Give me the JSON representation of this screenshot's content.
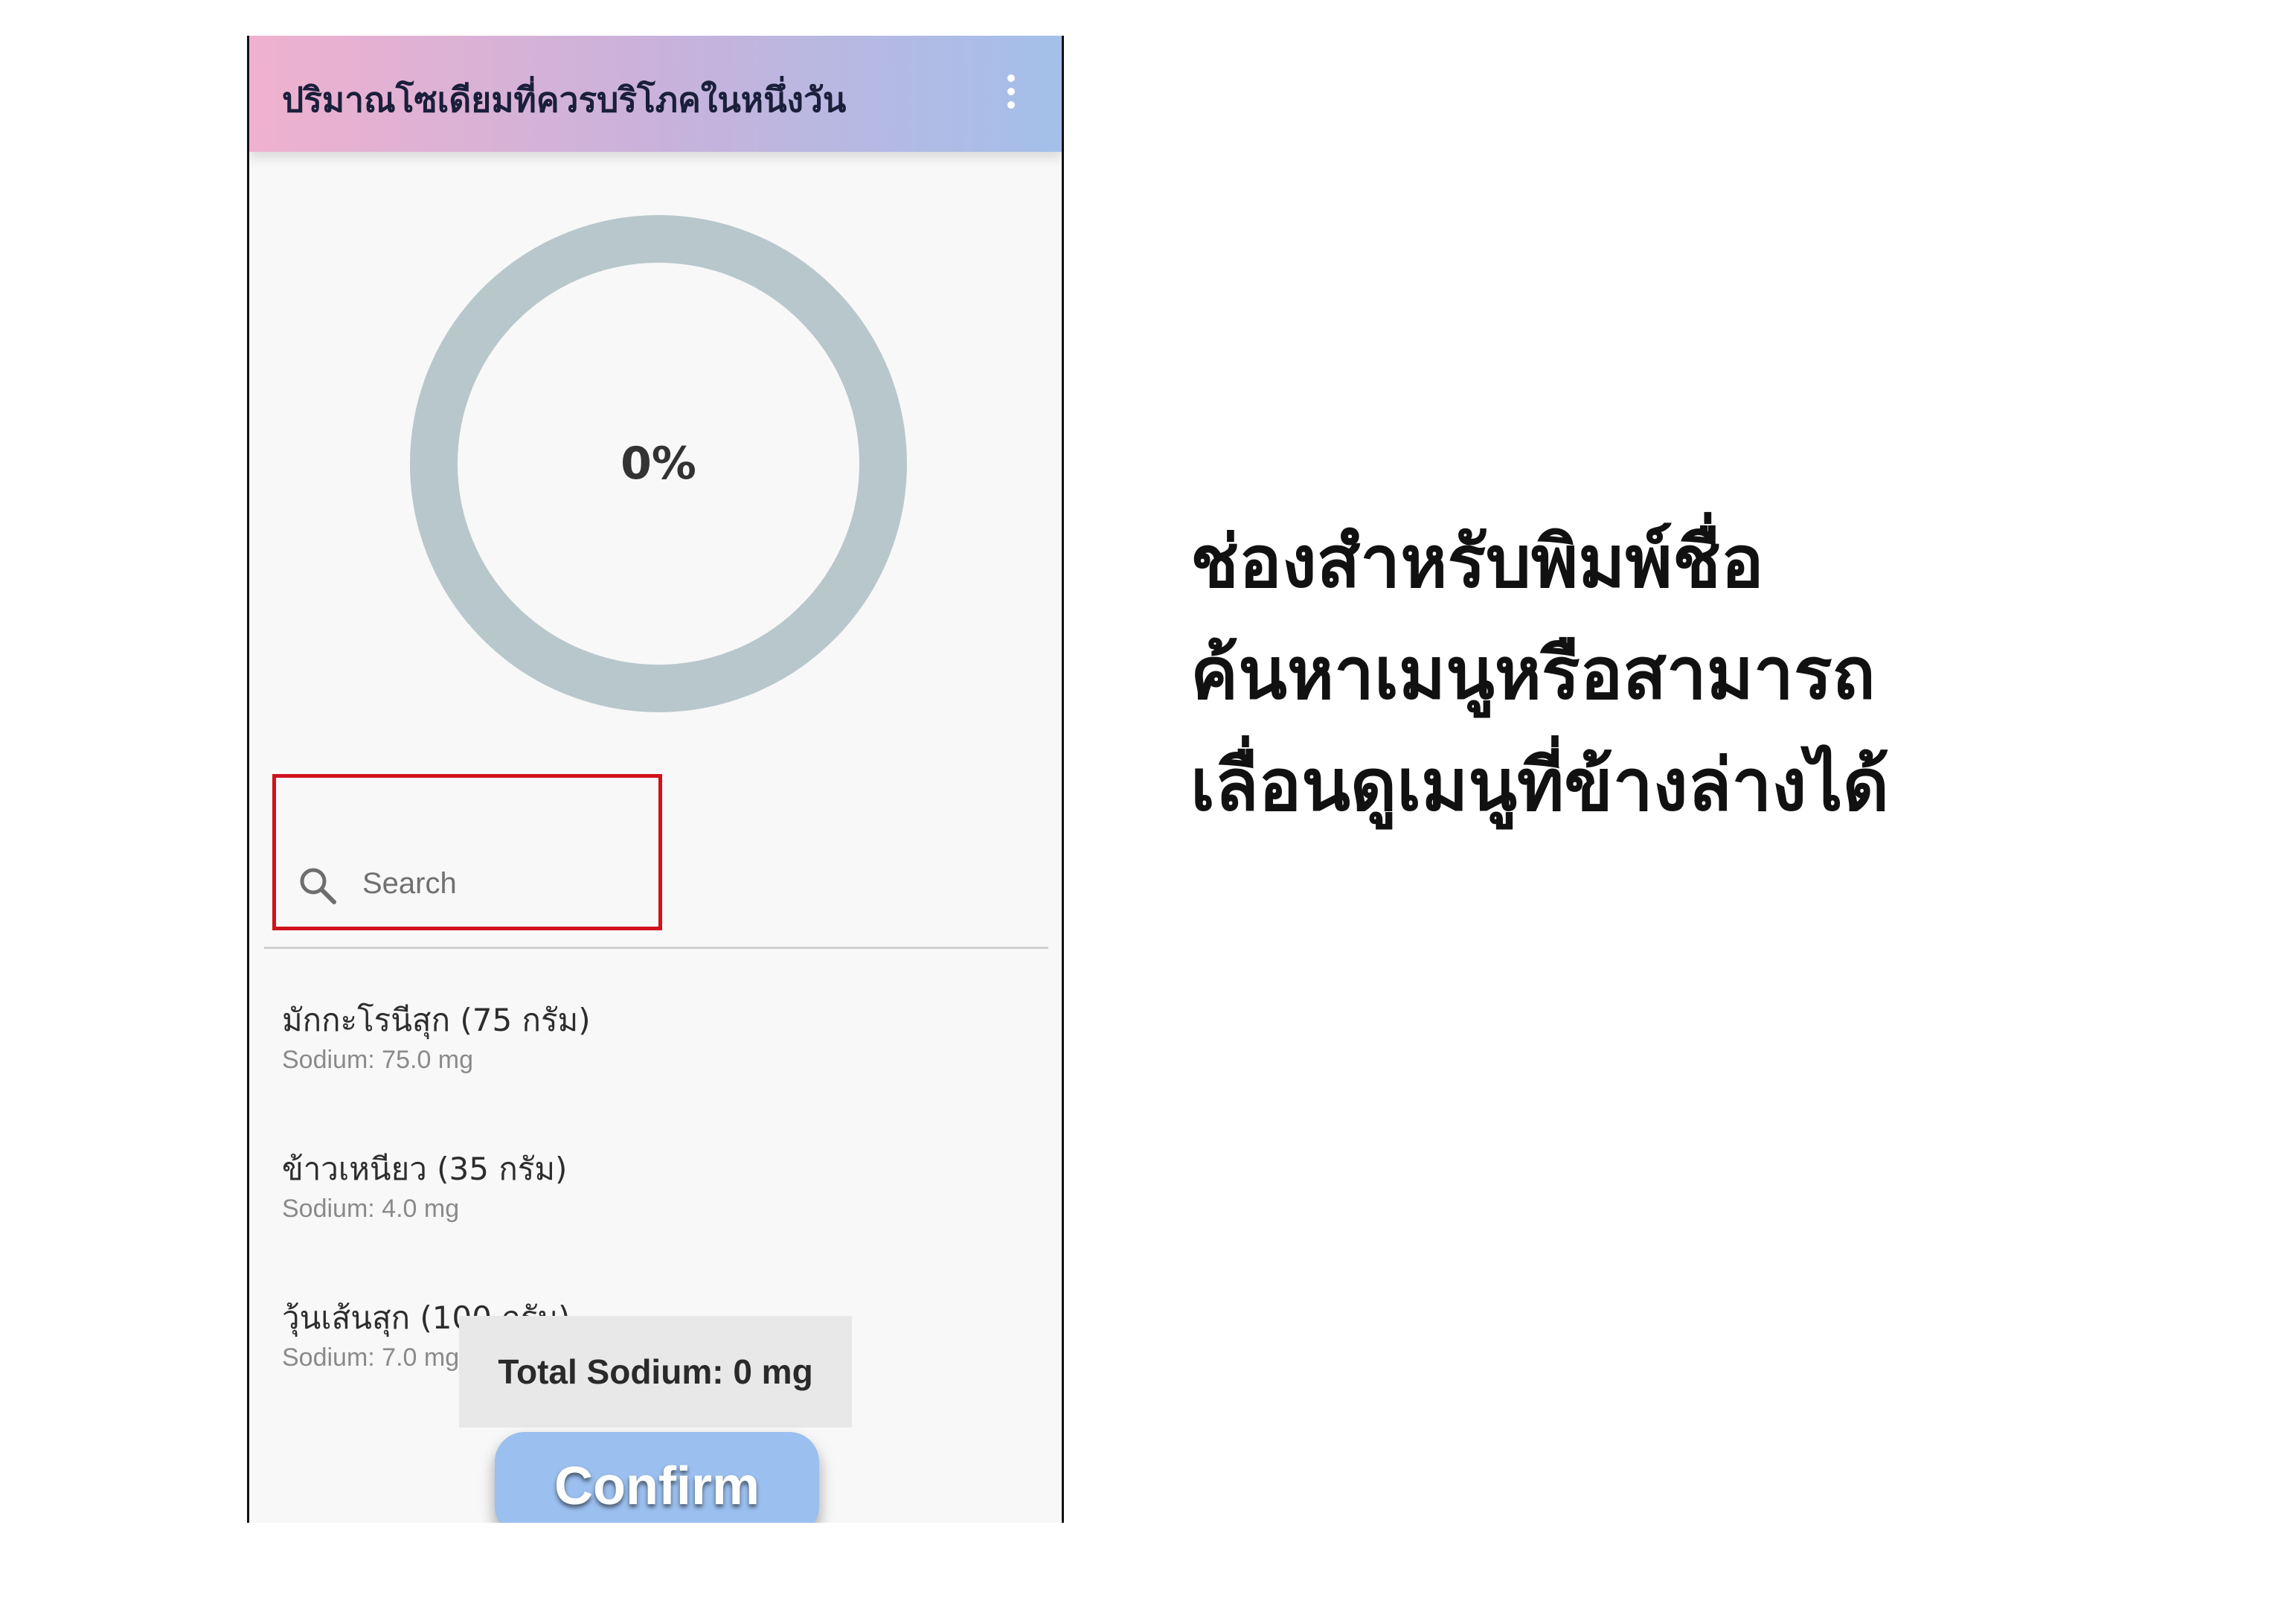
{
  "appbar": {
    "title": "ปริมาณโซเดียมที่ควรบริโภคในหนึ่งวัน",
    "menu_icon": "more-vert-icon"
  },
  "progress": {
    "label": "0%",
    "value": 0,
    "track_color": "#b8c7cc",
    "fill_color": "#7fa7d9"
  },
  "search": {
    "placeholder": "Search",
    "value": "",
    "icon": "search-icon"
  },
  "food_list": [
    {
      "name": "มักกะโรนีสุก (75 กรัม)",
      "sodium": "Sodium: 75.0 mg"
    },
    {
      "name": "ข้าวเหนียว (35 กรัม)",
      "sodium": "Sodium: 4.0 mg"
    },
    {
      "name": "วุ้นเส้นสุก (100 กรัม)",
      "sodium": "Sodium: 7.0 mg"
    }
  ],
  "total": {
    "label": "Total Sodium: 0 mg"
  },
  "confirm": {
    "label": "Confirm"
  },
  "annotation": {
    "lines": [
      "ช่องสำหรับพิมพ์ชื่อ",
      "ค้นหาเมนูหรือสามารถ",
      "เลื่อนดูเมนูที่ข้างล่างได้"
    ],
    "highlight_color": "#d0121b"
  }
}
